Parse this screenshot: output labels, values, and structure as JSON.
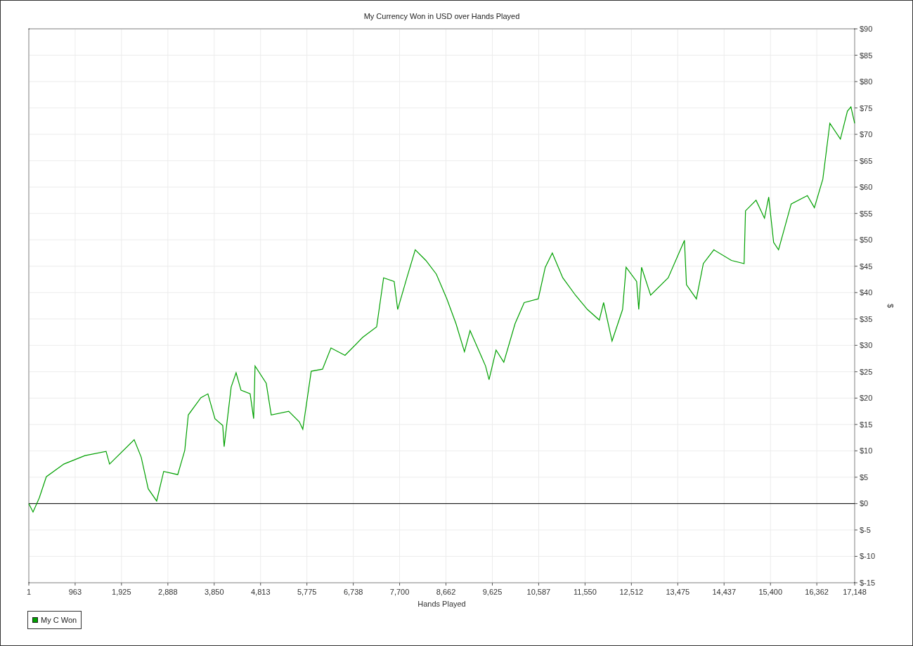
{
  "chart": {
    "chart_data": {
      "type": "line",
      "title": "My Currency Won in USD over Hands Played",
      "xlabel": "Hands Played",
      "ylabel": "$",
      "x": [
        1,
        88,
        219,
        365,
        730,
        1167,
        1605,
        1678,
        2189,
        2334,
        2480,
        2655,
        2801,
        3093,
        3239,
        3312,
        3575,
        3720,
        3866,
        4027,
        4056,
        4202,
        4304,
        4406,
        4596,
        4669,
        4698,
        4931,
        5034,
        5398,
        5617,
        5690,
        5865,
        6099,
        6274,
        6566,
        6931,
        7223,
        7368,
        7587,
        7660,
        7850,
        8025,
        8244,
        8462,
        8681,
        8871,
        9046,
        9163,
        9484,
        9557,
        9703,
        9863,
        10096,
        10286,
        10578,
        10724,
        10870,
        11088,
        11351,
        11599,
        11847,
        11935,
        12110,
        12329,
        12402,
        12621,
        12665,
        12723,
        12912,
        13277,
        13613,
        13656,
        13861,
        14006,
        14225,
        14590,
        14853,
        14882,
        15101,
        15276,
        15363,
        15465,
        15568,
        15830,
        16166,
        16312,
        16487,
        16633,
        16852,
        16998,
        17071,
        17148
      ],
      "series": [
        {
          "name": "My C Won",
          "color": "#00a000",
          "values": [
            0,
            -1.6,
            1.1,
            5.1,
            7.5,
            9.1,
            9.9,
            7.5,
            12.1,
            8.8,
            2.8,
            0.5,
            6.1,
            5.5,
            10.1,
            16.8,
            20.1,
            20.8,
            16.1,
            14.8,
            10.8,
            22.1,
            24.8,
            21.5,
            20.8,
            16.1,
            26.1,
            22.8,
            16.8,
            17.5,
            15.5,
            14.1,
            25.1,
            25.5,
            29.5,
            28.1,
            31.5,
            33.5,
            42.8,
            42.1,
            36.8,
            42.8,
            48.1,
            46.1,
            43.5,
            38.8,
            34.1,
            28.8,
            32.8,
            26.1,
            23.5,
            29.1,
            26.8,
            34.1,
            38.1,
            38.8,
            44.8,
            47.5,
            42.8,
            39.5,
            36.8,
            34.8,
            38.1,
            30.8,
            36.8,
            44.8,
            42.1,
            36.8,
            44.8,
            39.5,
            42.8,
            49.9,
            41.5,
            38.8,
            45.5,
            48.1,
            46.1,
            45.5,
            55.5,
            57.5,
            54.1,
            58.1,
            49.5,
            48.1,
            56.8,
            58.4,
            56.1,
            61.5,
            72.1,
            69.1,
            74.4,
            75.2,
            72.1
          ]
        }
      ],
      "xlim": [
        1,
        17148
      ],
      "ylim": [
        -15,
        90
      ],
      "grid": true,
      "xticks": [
        {
          "value": 1,
          "label": "1"
        },
        {
          "value": 963,
          "label": "963"
        },
        {
          "value": 1925,
          "label": "1,925"
        },
        {
          "value": 2888,
          "label": "2,888"
        },
        {
          "value": 3850,
          "label": "3,850"
        },
        {
          "value": 4813,
          "label": "4,813"
        },
        {
          "value": 5775,
          "label": "5,775"
        },
        {
          "value": 6738,
          "label": "6,738"
        },
        {
          "value": 7700,
          "label": "7,700"
        },
        {
          "value": 8662,
          "label": "8,662"
        },
        {
          "value": 9625,
          "label": "9,625"
        },
        {
          "value": 10587,
          "label": "10,587"
        },
        {
          "value": 11550,
          "label": "11,550"
        },
        {
          "value": 12512,
          "label": "12,512"
        },
        {
          "value": 13475,
          "label": "13,475"
        },
        {
          "value": 14437,
          "label": "14,437"
        },
        {
          "value": 15400,
          "label": "15,400"
        },
        {
          "value": 16362,
          "label": "16,362"
        },
        {
          "value": 17148,
          "label": "17,148"
        }
      ],
      "yticks": [
        {
          "value": 90,
          "label": "$90"
        },
        {
          "value": 85,
          "label": "$85"
        },
        {
          "value": 80,
          "label": "$80"
        },
        {
          "value": 75,
          "label": "$75"
        },
        {
          "value": 70,
          "label": "$70"
        },
        {
          "value": 65,
          "label": "$65"
        },
        {
          "value": 60,
          "label": "$60"
        },
        {
          "value": 55,
          "label": "$55"
        },
        {
          "value": 50,
          "label": "$50"
        },
        {
          "value": 45,
          "label": "$45"
        },
        {
          "value": 40,
          "label": "$40"
        },
        {
          "value": 35,
          "label": "$35"
        },
        {
          "value": 30,
          "label": "$30"
        },
        {
          "value": 25,
          "label": "$25"
        },
        {
          "value": 20,
          "label": "$20"
        },
        {
          "value": 15,
          "label": "$15"
        },
        {
          "value": 10,
          "label": "$10"
        },
        {
          "value": 5,
          "label": "$5"
        },
        {
          "value": 0,
          "label": "$0"
        },
        {
          "value": -5,
          "label": "$-5"
        },
        {
          "value": -10,
          "label": "$-10"
        },
        {
          "value": -15,
          "label": "$-15"
        }
      ]
    }
  },
  "legend_shown": true
}
